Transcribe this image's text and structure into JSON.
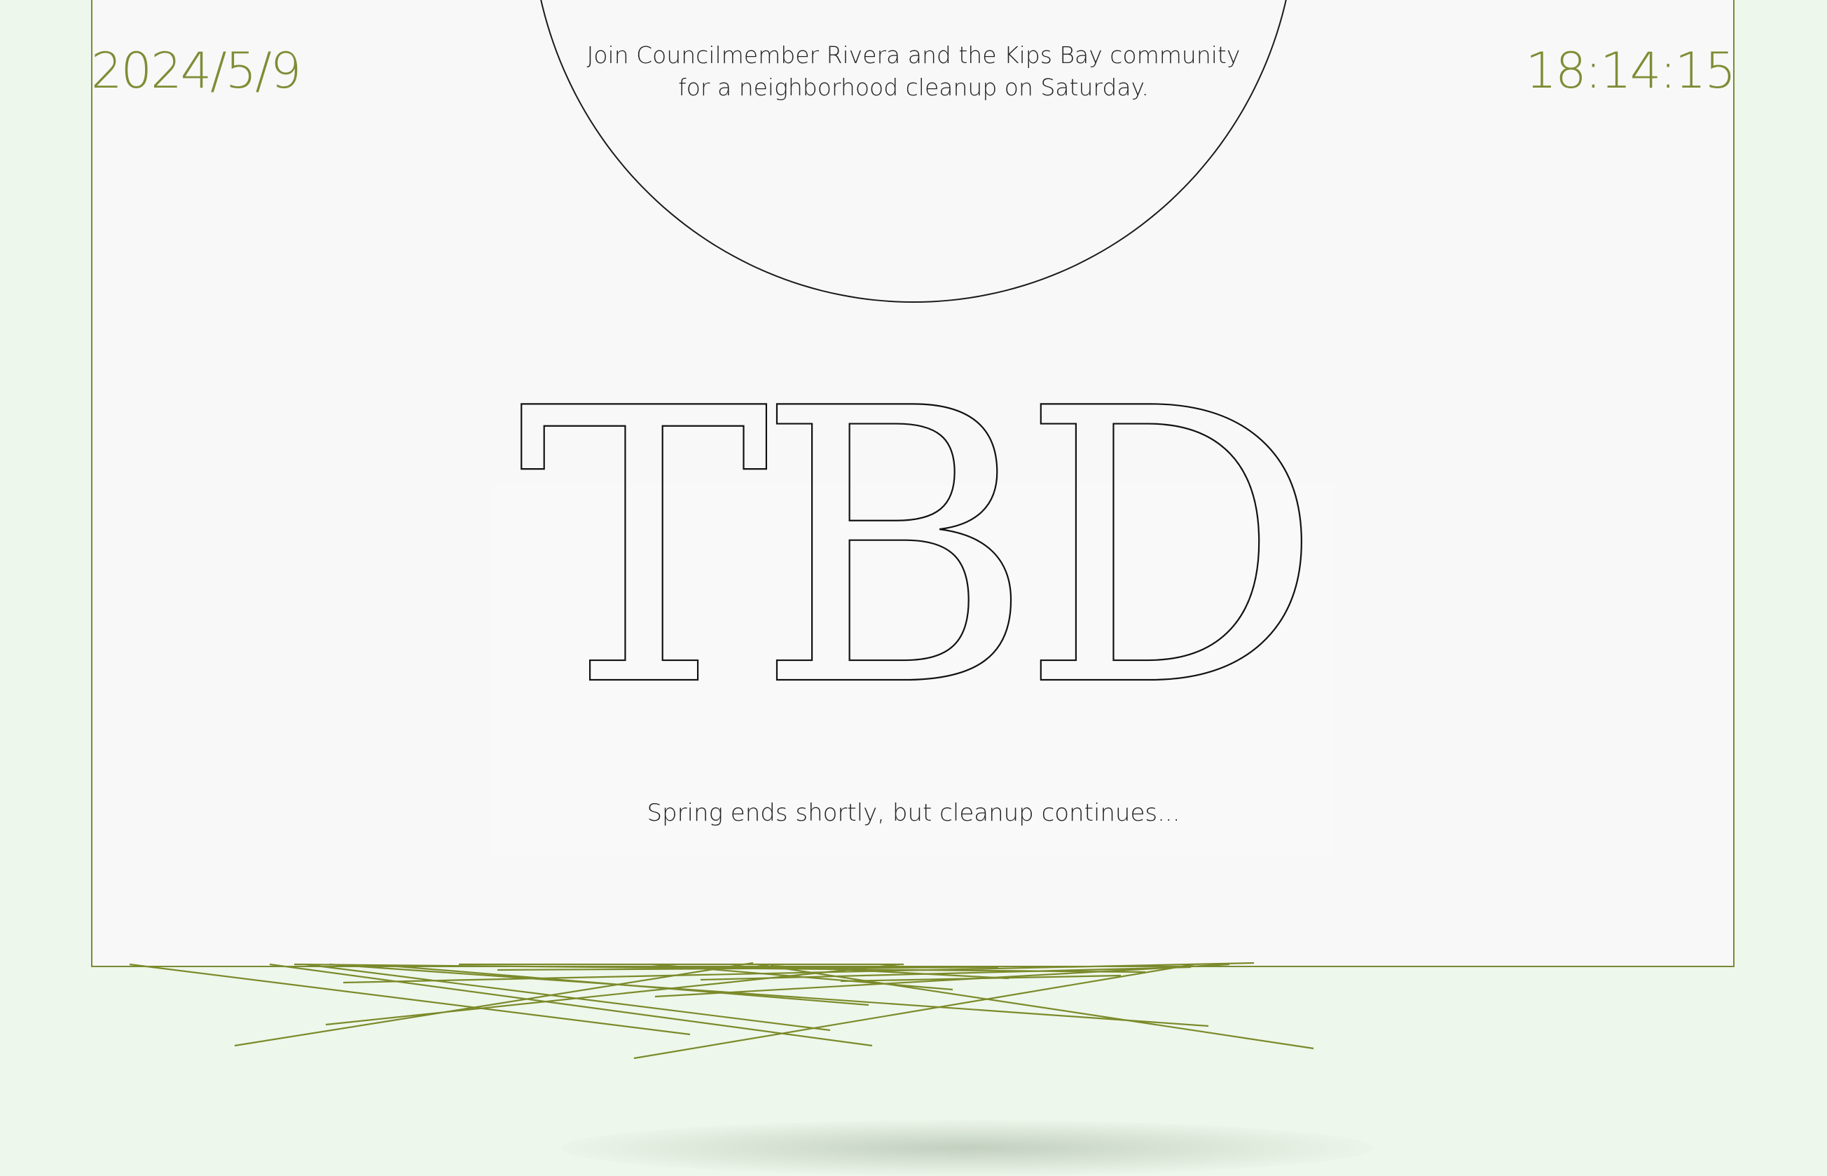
{
  "header": {
    "date": "2024/5/9",
    "time": "18:14:15"
  },
  "intro": {
    "line1": "Join Councilmember Rivera and the Kips Bay community",
    "line2": "for a neighborhood cleanup on Saturday."
  },
  "hero": {
    "title": "TBD",
    "tagline": "Spring ends shortly, but cleanup continues..."
  },
  "colors": {
    "background": "#eef7eb",
    "panel": "#f8f8f8",
    "accent": "#7f8c35",
    "ink": "#111111"
  }
}
